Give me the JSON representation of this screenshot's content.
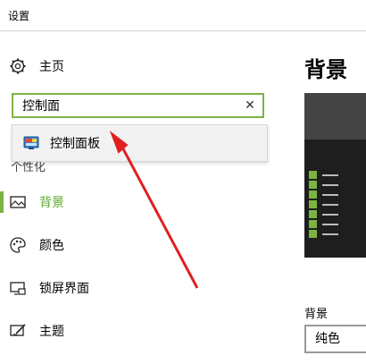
{
  "window": {
    "title": "设置"
  },
  "nav": {
    "home_label": "主页",
    "search": {
      "value": "控制面",
      "clear_glyph": "✕"
    },
    "suggestion": {
      "label": "控制面板"
    },
    "section_header": "个性化",
    "items": [
      {
        "id": "background",
        "label": "背景",
        "icon": "picture-icon",
        "active": true
      },
      {
        "id": "colors",
        "label": "颜色",
        "icon": "palette-icon",
        "active": false
      },
      {
        "id": "lockscreen",
        "label": "锁屏界面",
        "icon": "monitor-icon",
        "active": false
      },
      {
        "id": "themes",
        "label": "主题",
        "icon": "brush-icon",
        "active": false
      }
    ]
  },
  "main": {
    "title": "背景",
    "background_label": "背景",
    "background_value": "纯色"
  },
  "colors": {
    "accent": "#7cb342",
    "arrow": "#e02020"
  }
}
